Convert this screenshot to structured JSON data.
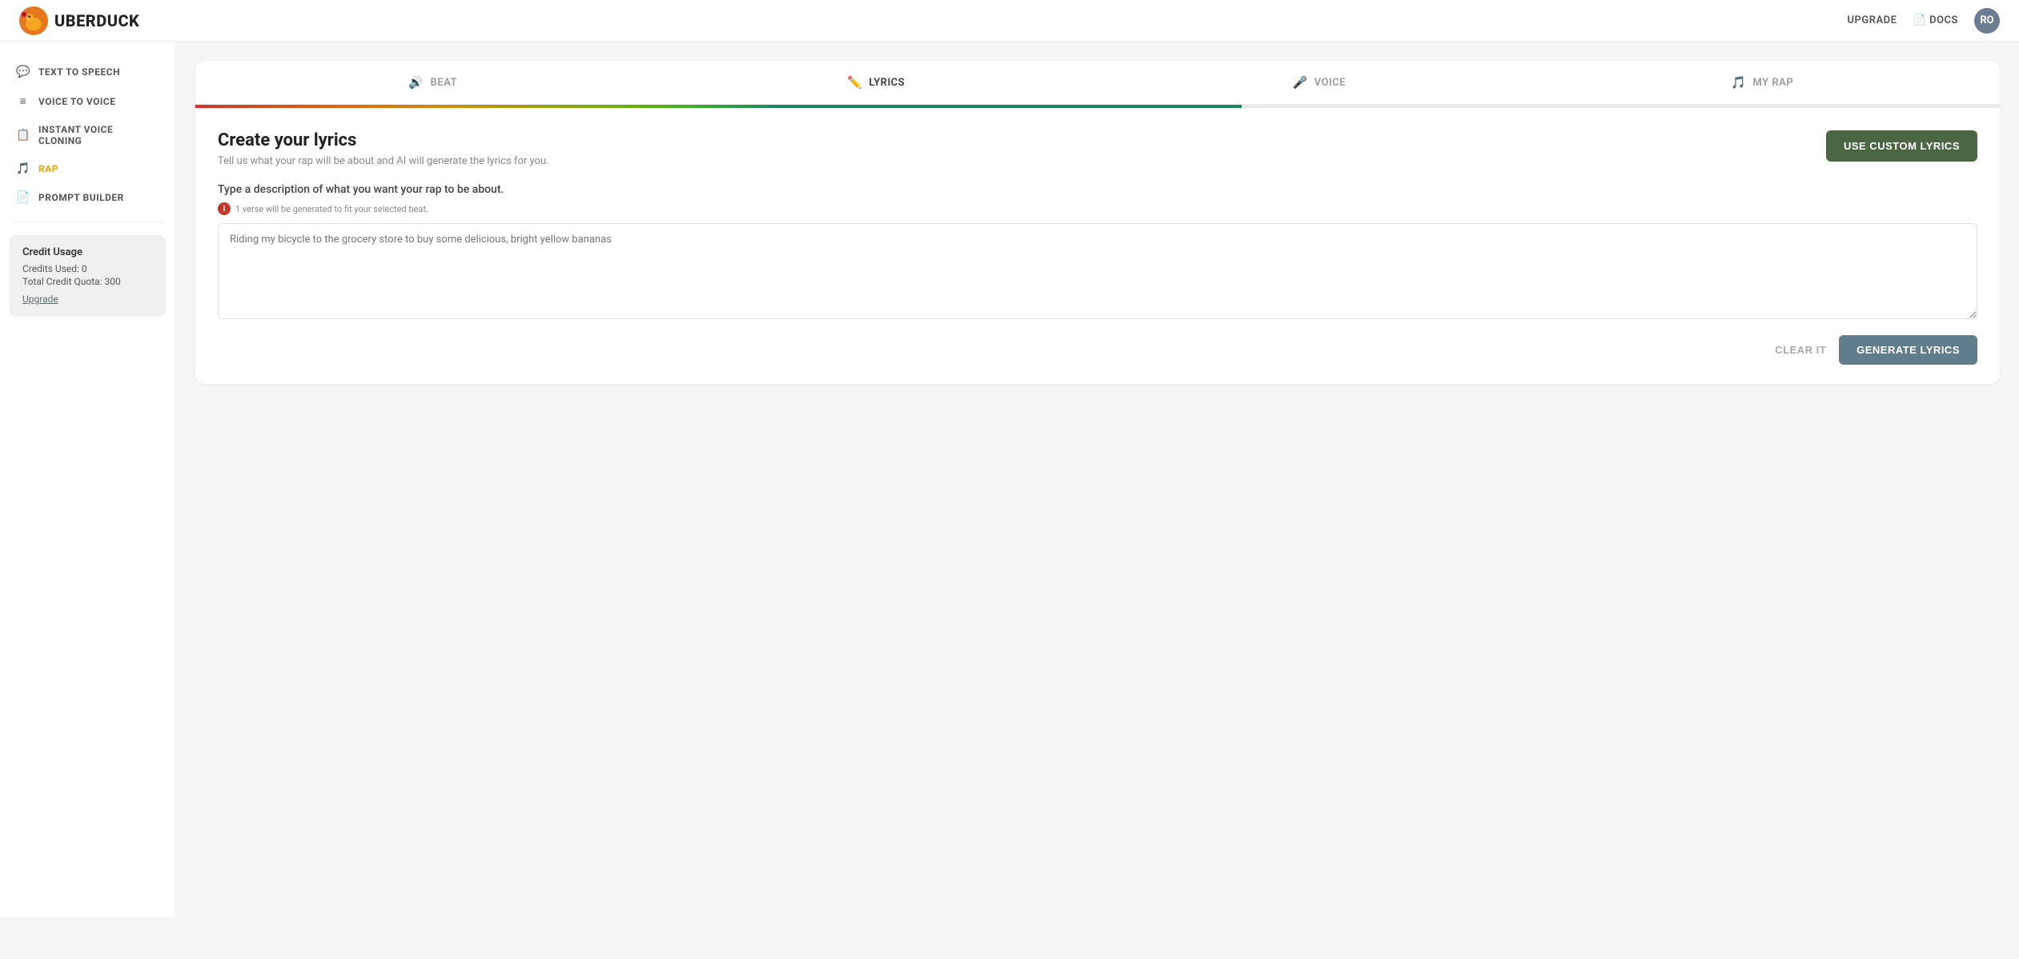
{
  "topnav": {
    "logo_text": "UBERDUCK",
    "upgrade_label": "UPGRADE",
    "docs_label": "DOCS",
    "avatar_initials": "RO"
  },
  "sidebar": {
    "items": [
      {
        "id": "text-to-speech",
        "label": "TEXT TO SPEECH",
        "icon": "💬"
      },
      {
        "id": "voice-to-voice",
        "label": "VOICE TO VOICE",
        "icon": "≡"
      },
      {
        "id": "instant-voice-cloning",
        "label": "INSTANT VOICE CLONING",
        "icon": "📋"
      },
      {
        "id": "rap",
        "label": "RAP",
        "icon": "🎵",
        "active": true
      },
      {
        "id": "prompt-builder",
        "label": "PROMPT BUILDER",
        "icon": "📄"
      }
    ],
    "credit_section": {
      "title": "Credit Usage",
      "credits_used_label": "Credits Used: 0",
      "total_quota_label": "Total Credit Quota: 300",
      "upgrade_label": "Upgrade"
    }
  },
  "tabs": [
    {
      "id": "beat",
      "label": "BEAT",
      "icon": "🔊"
    },
    {
      "id": "lyrics",
      "label": "LYRICS",
      "icon": "✏️",
      "active": true
    },
    {
      "id": "voice",
      "label": "VOICE",
      "icon": "🎤"
    },
    {
      "id": "my-rap",
      "label": "MY RAP",
      "icon": "🎵"
    }
  ],
  "lyrics_panel": {
    "title": "Create your lyrics",
    "subtitle": "Tell us what your rap will be about and AI will generate the lyrics for you.",
    "use_custom_label": "USE CUSTOM LYRICS",
    "form_label": "Type a description of what you want your rap to be about.",
    "info_note": "1 verse will be generated to fit your selected beat.",
    "textarea_placeholder": "Riding my bicycle to the grocery store to buy some delicious, bright yellow bananas",
    "clear_label": "CLEAR IT",
    "generate_label": "GENERATE LYRICS"
  }
}
